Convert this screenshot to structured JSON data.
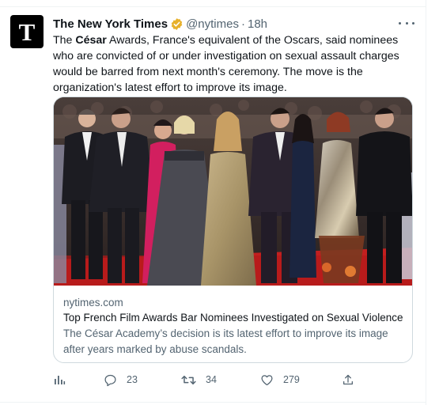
{
  "tweet": {
    "author_name": "The New York Times",
    "author_handle": "@nytimes",
    "separator": "·",
    "time": "18h",
    "avatar_letter": "T",
    "text_before_bold": "The ",
    "text_bold": "César",
    "text_after_bold": " Awards, France's equivalent of the Oscars, said nominees who are convicted of or under investigation on sexual assault charges would be barred from next month's ceremony. The move is the organization's latest effort to improve its image."
  },
  "card": {
    "domain": "nytimes.com",
    "title": "Top French Film Awards Bar Nominees Investigated on Sexual Violence",
    "description": "The César Academy’s decision is its latest effort to improve its image after years marked by abuse scandals."
  },
  "actions": {
    "analytics_icon": "bar-chart-icon",
    "reply_icon": "speech-bubble-icon",
    "reply_count": "23",
    "retweet_icon": "retweet-arrows-icon",
    "retweet_count": "34",
    "like_icon": "heart-outline-icon",
    "like_count": "279",
    "share_icon": "upload-arrow-icon"
  },
  "colors": {
    "text_primary": "#0f1419",
    "text_secondary": "#536471",
    "verified_badge": "#e7b12b",
    "card_border": "#cfd9de",
    "red_carpet": "#c21f1f"
  }
}
